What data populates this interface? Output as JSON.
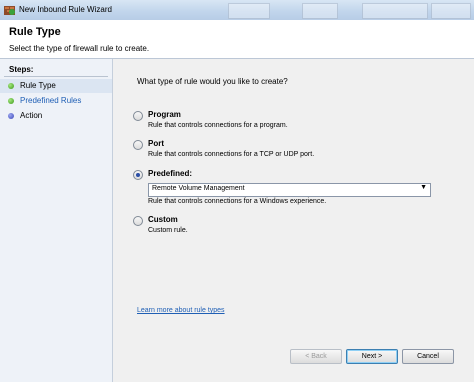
{
  "window": {
    "title": "New Inbound Rule Wizard"
  },
  "header": {
    "title": "Rule Type",
    "subtitle": "Select the type of firewall rule to create."
  },
  "steps": {
    "title": "Steps:",
    "items": [
      {
        "label": "Rule Type",
        "state": "current",
        "color": "#3a9a18"
      },
      {
        "label": "Predefined Rules",
        "state": "link",
        "color": "#3a9a18"
      },
      {
        "label": "Action",
        "state": "pending",
        "color": "#3b47b8"
      }
    ]
  },
  "main": {
    "question": "What type of rule would you like to create?",
    "options": [
      {
        "title": "Program",
        "description": "Rule that controls connections for a program.",
        "selected": false
      },
      {
        "title": "Port",
        "description": "Rule that controls connections for a TCP or UDP port.",
        "selected": false
      },
      {
        "title": "Predefined:",
        "description": "Rule that controls connections for a Windows experience.",
        "selected": true
      },
      {
        "title": "Custom",
        "description": "Custom rule.",
        "selected": false
      }
    ],
    "predefined_select": {
      "value": "Remote Volume Management"
    },
    "learn_link": "Learn more about rule types"
  },
  "buttons": {
    "back": "< Back",
    "next": "Next >",
    "cancel": "Cancel"
  },
  "colors": {
    "link": "#1f5fb5",
    "accent": "#3c7fb1"
  }
}
